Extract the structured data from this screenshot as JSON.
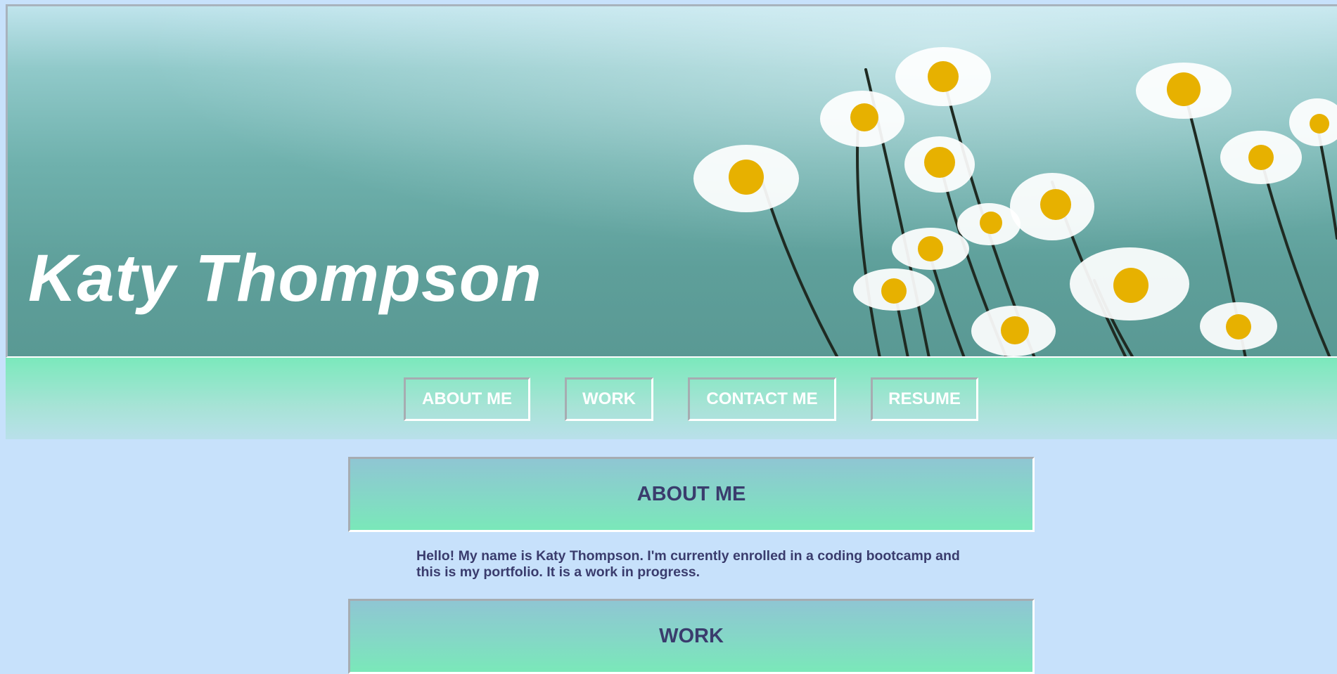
{
  "header": {
    "name": "Katy Thompson"
  },
  "nav": {
    "items": [
      {
        "label": "ABOUT ME"
      },
      {
        "label": "WORK"
      },
      {
        "label": "CONTACT ME"
      },
      {
        "label": "RESUME"
      }
    ]
  },
  "sections": {
    "about": {
      "title": "ABOUT ME",
      "body": "Hello! My name is Katy Thompson. I'm currently enrolled in a coding bootcamp and this is my portfolio. It is a work in progress."
    },
    "work": {
      "title": "WORK"
    }
  },
  "colors": {
    "page_background": "#c7e1fb",
    "nav_gradient_top": "#7be9bc",
    "heading_text": "#3a3c6d",
    "nav_text": "#ffffff"
  }
}
